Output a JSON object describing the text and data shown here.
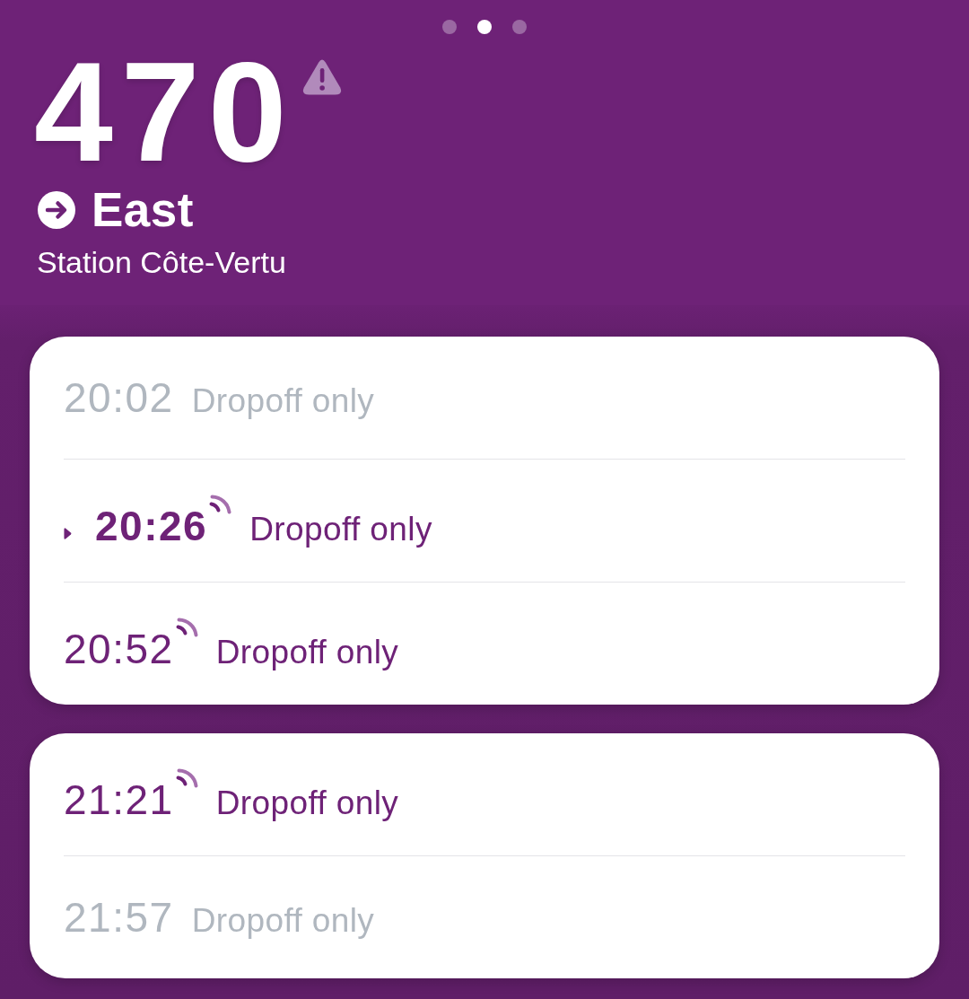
{
  "pager": {
    "pages": [
      {
        "selected": false
      },
      {
        "selected": true
      },
      {
        "selected": false
      }
    ]
  },
  "header": {
    "route": "470",
    "alert": true,
    "direction": "East",
    "stop": "Station Côte-Vertu"
  },
  "groups": [
    {
      "rows": [
        {
          "time": "20:02",
          "note": "Dropoff only",
          "selected": false,
          "realtime": false,
          "muted": true
        },
        {
          "time": "20:26",
          "note": "Dropoff only",
          "selected": true,
          "realtime": true,
          "muted": false
        },
        {
          "time": "20:52",
          "note": "Dropoff only",
          "selected": false,
          "realtime": true,
          "muted": false
        }
      ]
    },
    {
      "rows": [
        {
          "time": "21:21",
          "note": "Dropoff only",
          "selected": false,
          "realtime": true,
          "muted": false
        },
        {
          "time": "21:57",
          "note": "Dropoff only",
          "selected": false,
          "realtime": false,
          "muted": true
        }
      ]
    }
  ]
}
